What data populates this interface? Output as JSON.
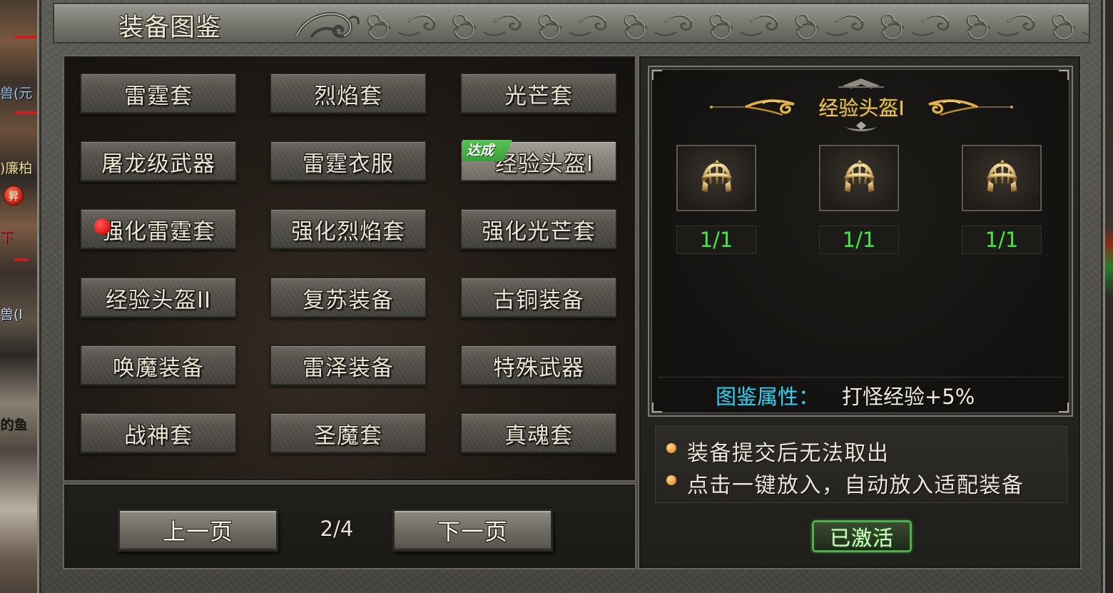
{
  "window": {
    "title": "装备图鉴"
  },
  "scene": {
    "fragments": [
      "兽(元",
      ")廉柏",
      "昇",
      "下",
      "兽(I",
      "的鱼"
    ]
  },
  "catalog": {
    "items": [
      {
        "label": "雷霆套"
      },
      {
        "label": "烈焰套"
      },
      {
        "label": "光芒套"
      },
      {
        "label": "屠龙级武器"
      },
      {
        "label": "雷霆衣服"
      },
      {
        "label": "经验头盔I",
        "selected": true,
        "badge": "达成"
      },
      {
        "label": "强化雷霆套",
        "alert_dot": true
      },
      {
        "label": "强化烈焰套"
      },
      {
        "label": "强化光芒套"
      },
      {
        "label": "经验头盔II"
      },
      {
        "label": "复苏装备"
      },
      {
        "label": "古铜装备"
      },
      {
        "label": "唤魔装备"
      },
      {
        "label": "雷泽装备"
      },
      {
        "label": "特殊武器"
      },
      {
        "label": "战神套"
      },
      {
        "label": "圣魔套"
      },
      {
        "label": "真魂套"
      }
    ]
  },
  "pagination": {
    "prev_label": "上一页",
    "page_indicator": "2/4",
    "next_label": "下一页"
  },
  "detail": {
    "title": "经验头盔I",
    "slots": [
      {
        "icon": "helmet-icon",
        "count": "1/1"
      },
      {
        "icon": "helmet-icon",
        "count": "1/1"
      },
      {
        "icon": "helmet-icon",
        "count": "1/1"
      }
    ],
    "attribute_label": "图鉴属性：",
    "attribute_value": "打怪经验+5%",
    "notes": [
      "装备提交后无法取出",
      "点击一键放入，自动放入适配装备"
    ],
    "status_button_label": "已激活"
  },
  "colors": {
    "title_text": "#efe6d2",
    "button_text": "#ebe3d3",
    "header_gold": "#e9c46a",
    "count_green": "#4fe04a",
    "attribute_label_cyan": "#3ec9e6",
    "attribute_value": "#f0ece4",
    "badge_green": "#3a9e3a",
    "alert_red": "#e01818",
    "activated_green": "#49b04a",
    "note_bullet": "#f0a040"
  }
}
